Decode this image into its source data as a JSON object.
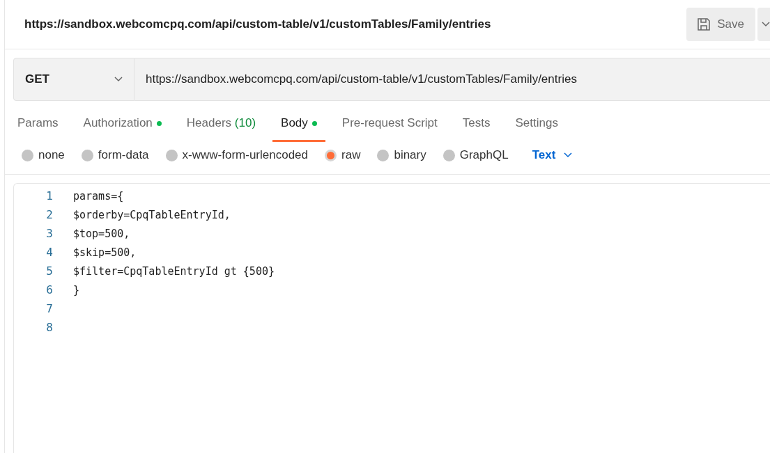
{
  "header": {
    "title": "https://sandbox.webcomcpq.com/api/custom-table/v1/customTables/Family/entries",
    "save_label": "Save"
  },
  "request": {
    "method": "GET",
    "url": "https://sandbox.webcomcpq.com/api/custom-table/v1/customTables/Family/entries"
  },
  "tabs": [
    {
      "label": "Params",
      "selected": false,
      "dot": false
    },
    {
      "label": "Authorization",
      "selected": false,
      "dot": true
    },
    {
      "label": "Headers",
      "count": "(10)",
      "selected": false,
      "dot": false
    },
    {
      "label": "Body",
      "selected": true,
      "dot": true
    },
    {
      "label": "Pre-request Script",
      "selected": false,
      "dot": false
    },
    {
      "label": "Tests",
      "selected": false,
      "dot": false
    },
    {
      "label": "Settings",
      "selected": false,
      "dot": false
    }
  ],
  "body_types": [
    {
      "label": "none",
      "selected": false
    },
    {
      "label": "form-data",
      "selected": false
    },
    {
      "label": "x-www-form-urlencoded",
      "selected": false
    },
    {
      "label": "raw",
      "selected": true
    },
    {
      "label": "binary",
      "selected": false
    },
    {
      "label": "GraphQL",
      "selected": false
    }
  ],
  "format": "Text",
  "editor": {
    "lines": [
      {
        "number": "1",
        "code": "params={"
      },
      {
        "number": "2",
        "code": "$orderby=CpqTableEntryId,"
      },
      {
        "number": "3",
        "code": "$top=500,"
      },
      {
        "number": "4",
        "code": "$skip=500,"
      },
      {
        "number": "5",
        "code": "$filter=CpqTableEntryId gt {500}"
      },
      {
        "number": "6",
        "code": "}"
      },
      {
        "number": "7"
      },
      {
        "number": "8"
      }
    ]
  }
}
